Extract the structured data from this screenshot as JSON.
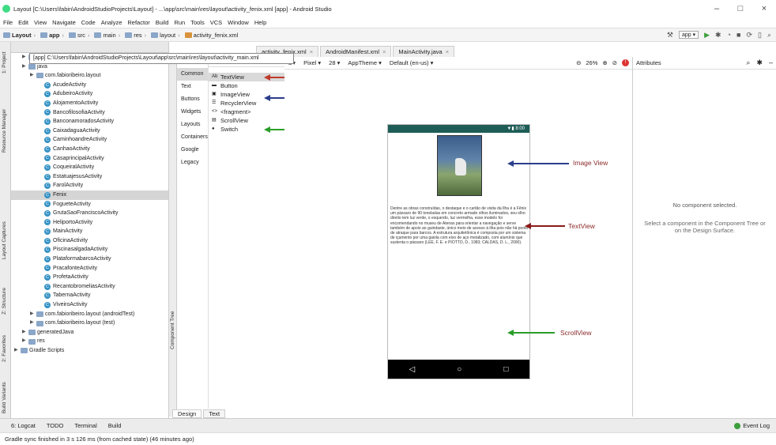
{
  "window": {
    "title": "Layout [C:\\Users\\fabin\\AndroidStudioProjects\\Layout] - ...\\app\\src\\main\\res\\layout\\activity_fenix.xml [app] - Android Studio",
    "minimize": "–",
    "maximize": "□",
    "close": "×"
  },
  "menu": [
    "File",
    "Edit",
    "View",
    "Navigate",
    "Code",
    "Analyze",
    "Refactor",
    "Build",
    "Run",
    "Tools",
    "VCS",
    "Window",
    "Help"
  ],
  "breadcrumb": [
    "Layout",
    "app",
    "src",
    "main",
    "res",
    "layout",
    "activity_fenix.xml"
  ],
  "nav_toolbar": {
    "run_config": "app ▾"
  },
  "tooltip": "[app] C:\\Users\\fabin\\AndroidStudioProjects\\Layout\\app\\src\\main\\res\\layout\\activity_main.xml",
  "left_strip": [
    "1: Project",
    "Resource Manager",
    "Layout Captures",
    "Z: Structure",
    "2: Favorites",
    "Build Variants"
  ],
  "project_tree": [
    {
      "label": "manifests",
      "indent": 1,
      "kind": "folder"
    },
    {
      "label": "java",
      "indent": 1,
      "kind": "folder"
    },
    {
      "label": "com.fabioribeiro.layout",
      "indent": 2,
      "kind": "package"
    },
    {
      "label": "AcudeActivity",
      "indent": 3,
      "kind": "class"
    },
    {
      "label": "AdubeiroActivity",
      "indent": 3,
      "kind": "class"
    },
    {
      "label": "AlojamentoActivity",
      "indent": 3,
      "kind": "class"
    },
    {
      "label": "BancofilosofiaActivity",
      "indent": 3,
      "kind": "class"
    },
    {
      "label": "BanconamoradosActivity",
      "indent": 3,
      "kind": "class"
    },
    {
      "label": "CaixadaguaActivity",
      "indent": 3,
      "kind": "class"
    },
    {
      "label": "CaminhoandreActivity",
      "indent": 3,
      "kind": "class"
    },
    {
      "label": "CanhaoActivity",
      "indent": 3,
      "kind": "class"
    },
    {
      "label": "CasaprincipalActivity",
      "indent": 3,
      "kind": "class"
    },
    {
      "label": "CoqueiralActivity",
      "indent": 3,
      "kind": "class"
    },
    {
      "label": "EstatuajesusActivity",
      "indent": 3,
      "kind": "class"
    },
    {
      "label": "FarolActivity",
      "indent": 3,
      "kind": "class"
    },
    {
      "label": "Fenix",
      "indent": 3,
      "kind": "class",
      "selected": true
    },
    {
      "label": "FogueteActivity",
      "indent": 3,
      "kind": "class"
    },
    {
      "label": "GrutaSaoFranciscoActivity",
      "indent": 3,
      "kind": "class"
    },
    {
      "label": "HeliportoActivity",
      "indent": 3,
      "kind": "class"
    },
    {
      "label": "MainActivity",
      "indent": 3,
      "kind": "class"
    },
    {
      "label": "OficinaActivity",
      "indent": 3,
      "kind": "class"
    },
    {
      "label": "PiscinasalgadaActivity",
      "indent": 3,
      "kind": "class"
    },
    {
      "label": "PlataformabarcoActivity",
      "indent": 3,
      "kind": "class"
    },
    {
      "label": "PracafonteActivity",
      "indent": 3,
      "kind": "class"
    },
    {
      "label": "ProfetaActivity",
      "indent": 3,
      "kind": "class"
    },
    {
      "label": "RecantobromeliasActivity",
      "indent": 3,
      "kind": "class"
    },
    {
      "label": "TabernaActivity",
      "indent": 3,
      "kind": "class"
    },
    {
      "label": "ViveiroActivity",
      "indent": 3,
      "kind": "class"
    },
    {
      "label": "com.fabioribeiro.layout (androidTest)",
      "indent": 2,
      "kind": "package"
    },
    {
      "label": "com.fabioribeiro.layout (test)",
      "indent": 2,
      "kind": "package"
    },
    {
      "label": "generatedJava",
      "indent": 1,
      "kind": "folder"
    },
    {
      "label": "res",
      "indent": 1,
      "kind": "folder"
    },
    {
      "label": "Gradle Scripts",
      "indent": 0,
      "kind": "gradle"
    }
  ],
  "editor_tabs": [
    {
      "label": "activity_fenix.xml",
      "active": true
    },
    {
      "label": "AndroidManifest.xml",
      "active": false
    },
    {
      "label": "MainActivity.java",
      "active": false
    }
  ],
  "palette": {
    "header": "Palette",
    "categories": [
      "Common",
      "Text",
      "Buttons",
      "Widgets",
      "Layouts",
      "Containers",
      "Google",
      "Legacy"
    ],
    "items": [
      {
        "icon": "Ab",
        "label": "TextView"
      },
      {
        "icon": "▬",
        "label": "Button"
      },
      {
        "icon": "▣",
        "label": "ImageView"
      },
      {
        "icon": "☰",
        "label": "RecyclerView"
      },
      {
        "icon": "<>",
        "label": "<fragment>"
      },
      {
        "icon": "▤",
        "label": "ScrollView"
      },
      {
        "icon": "●",
        "label": "Switch"
      }
    ],
    "component_tree_label": "Component Tree"
  },
  "design_toolbar": {
    "device": "Pixel ▾",
    "api": "28 ▾",
    "theme": "AppTheme ▾",
    "locale": "Default (en-us) ▾",
    "zoom": "26%"
  },
  "phone": {
    "status_time": "8:00",
    "paragraph": "Dentre as obras construídas, o destaque e o cartão de visita da Ilha é a Fênix um pássaro de 90 toneladas em concreto armado olhos iluminados, seu olho direito tem luz verde, o esquerdo, luz vermelha, esse modelo foi encomendando no museu de Atenas para orientar a navegação e serve também de apoio ao guindaste, único meio de acesso à ilha pois não há ponto de atraque para barcos. A estrutura arquitetônica é composta por um sistema de içamento por uma gaiola com eixo de aço metalizado, com alumínio que sustenta o pássaro (LEE, F. E. e PIOTTO, D., 1983; CALDAS, D. L., 2000).",
    "nav": [
      "◁",
      "○",
      "□"
    ]
  },
  "annotations": [
    {
      "label": "Image View",
      "color": "#8b2a2a",
      "arrow": "#2b3e8c"
    },
    {
      "label": "TextView",
      "color": "#8b2a2a",
      "arrow": "#8b1a1a"
    },
    {
      "label": "ScrollView",
      "color": "#8b2a2a",
      "arrow": "#2a9e2a"
    }
  ],
  "attributes": {
    "header": "Attributes",
    "empty": "No component selected.",
    "hint": "Select a component in the Component Tree or on the Design Surface."
  },
  "bottom_tabs": [
    "Design",
    "Text"
  ],
  "tool_windows": [
    "6: Logcat",
    "TODO",
    "Terminal",
    "Build"
  ],
  "event_log": "Event Log",
  "status": "Gradle sync finished in 3 s 126 ms (from cached state) (46 minutes ago)",
  "colors": {
    "statusbar": "#1e5d57",
    "selected": "#d5d5d5",
    "class_icon": "#3592c4",
    "arrow_red": "#c0392b",
    "arrow_blue": "#2b3e8c",
    "arrow_green": "#2a9e2a"
  }
}
